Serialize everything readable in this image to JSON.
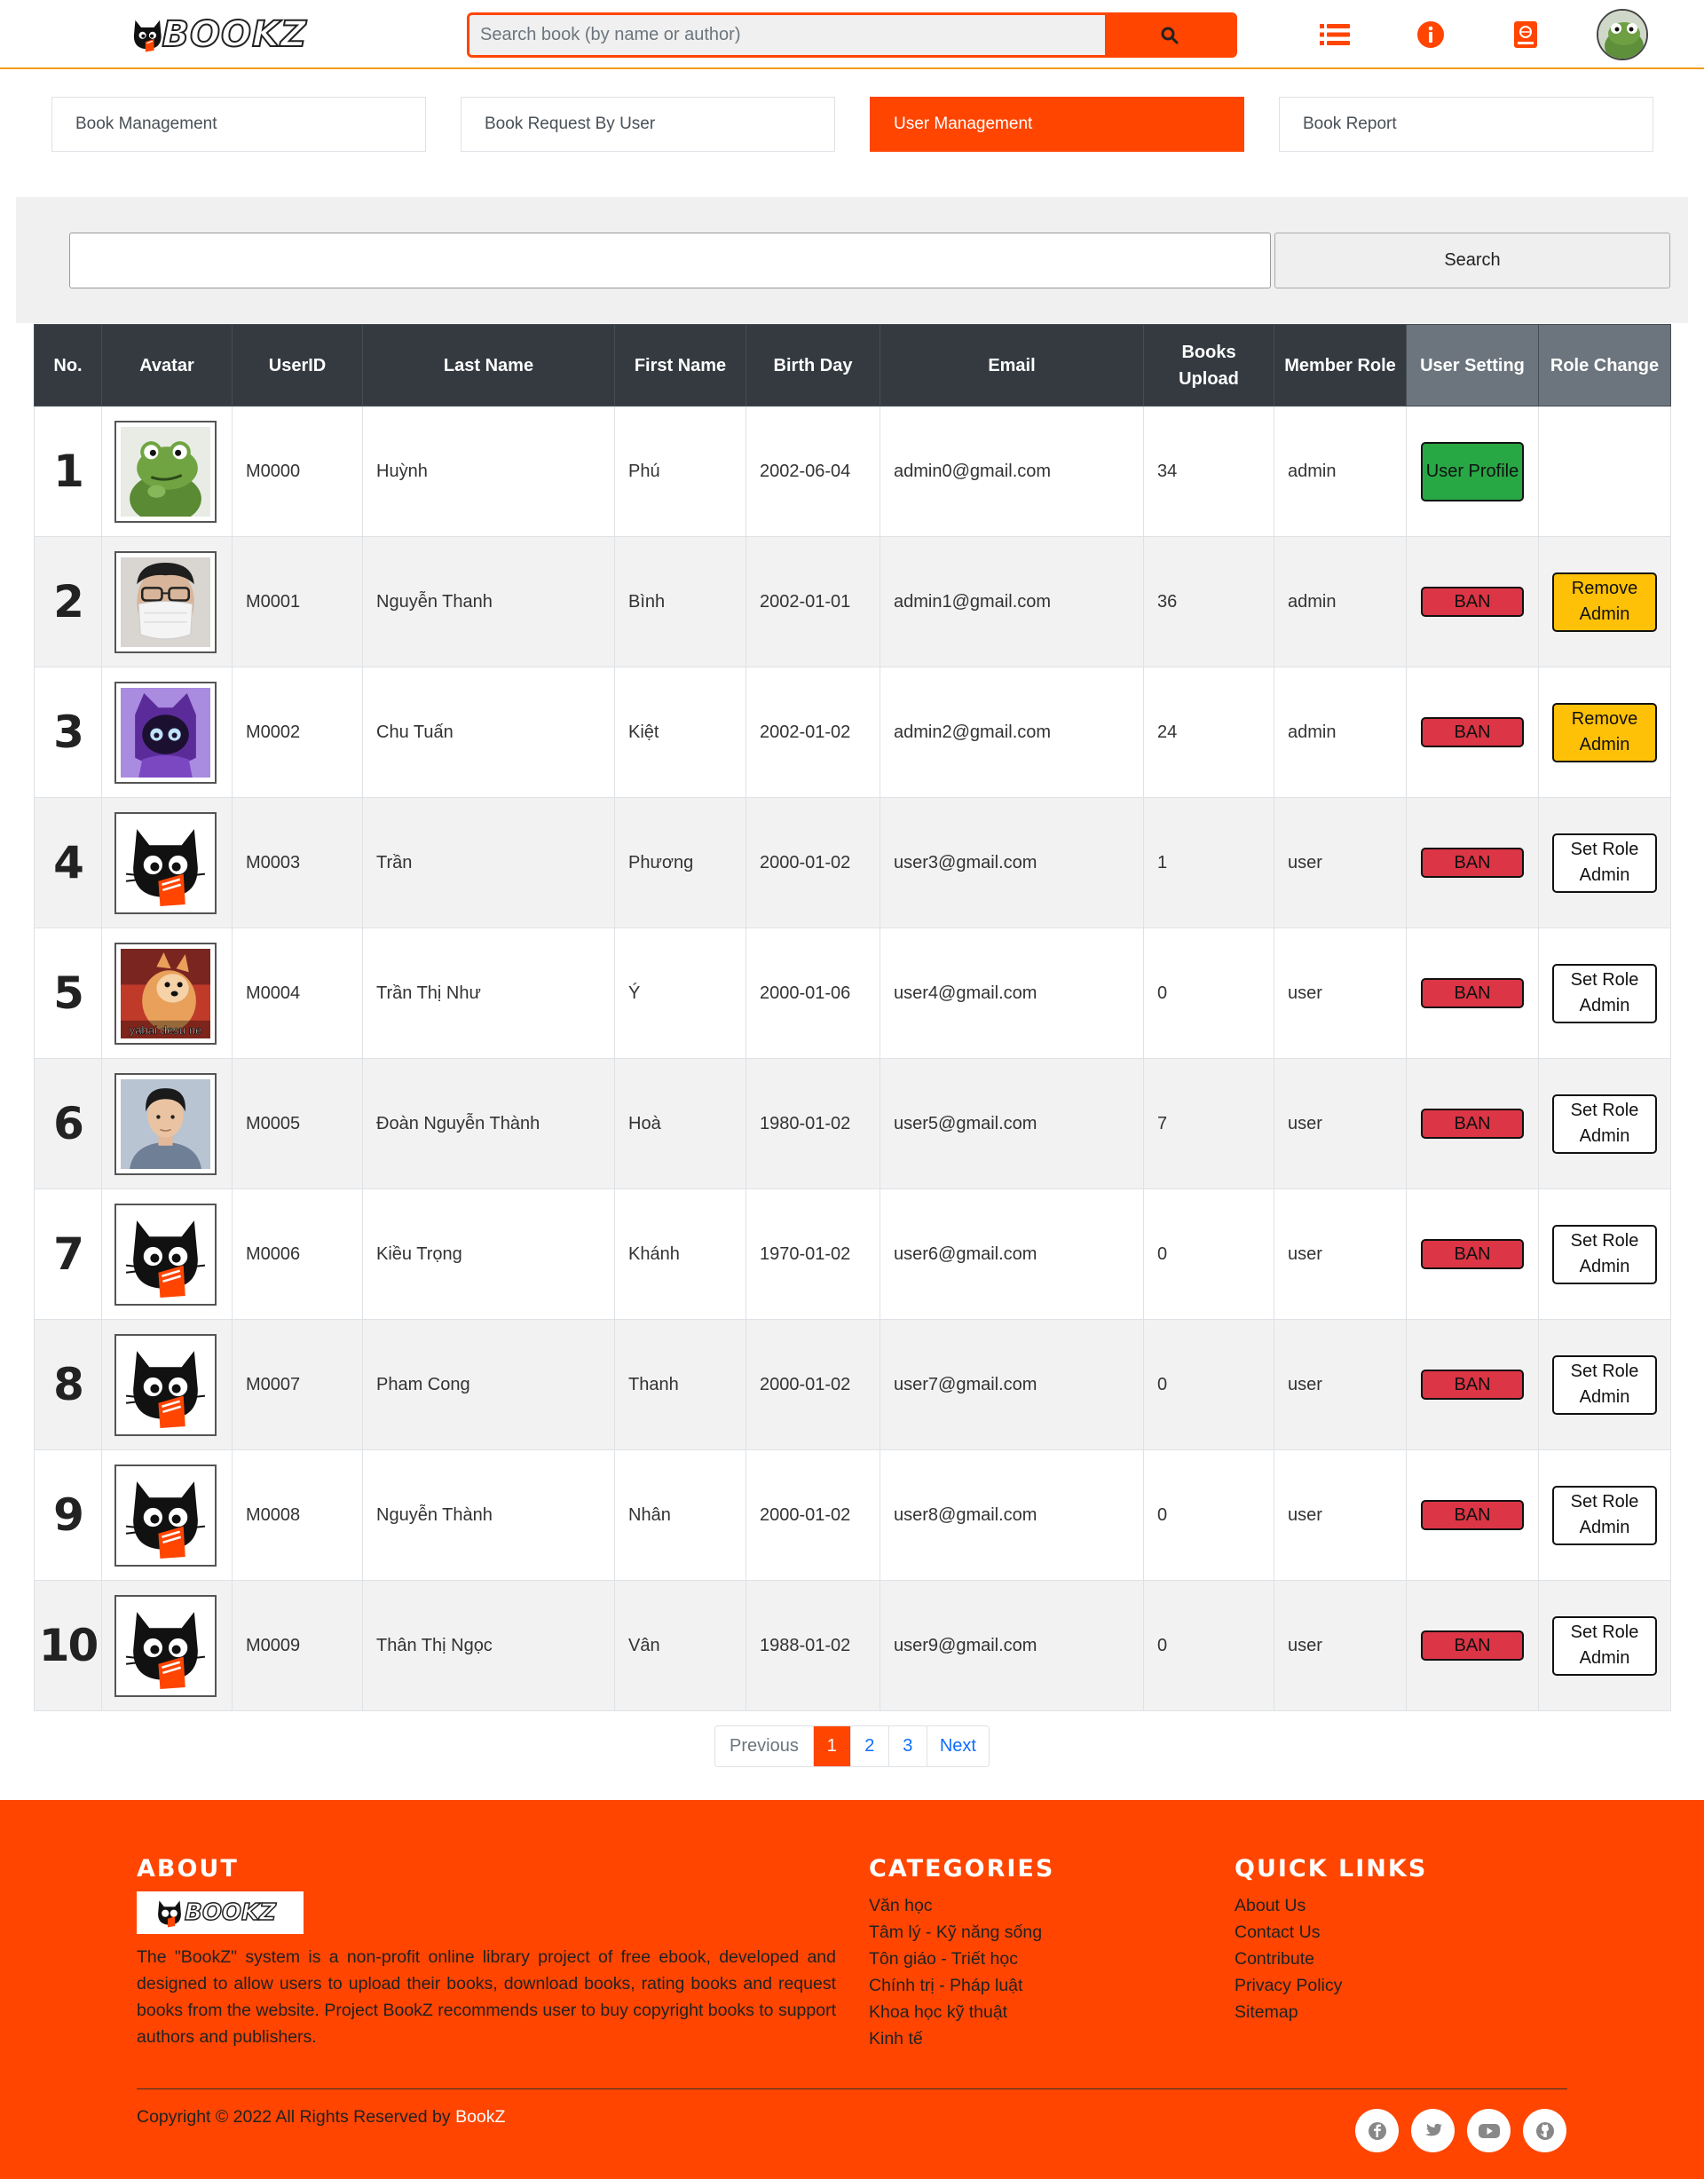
{
  "header": {
    "logo_text": "BOOKZ",
    "search_placeholder": "Search book (by name or author)",
    "icons": [
      "list-icon",
      "info-icon",
      "book-icon",
      "user-avatar"
    ]
  },
  "tabs": [
    {
      "label": "Book Management",
      "active": false
    },
    {
      "label": "Book Request By User",
      "active": false
    },
    {
      "label": "User Management",
      "active": true
    },
    {
      "label": "Book Report",
      "active": false
    }
  ],
  "user_search": {
    "value": "",
    "button_label": "Search"
  },
  "table": {
    "headers": [
      "No.",
      "Avatar",
      "UserID",
      "Last Name",
      "First Name",
      "Birth Day",
      "Email",
      "Books Upload",
      "Member Role",
      "User Setting",
      "Role Change"
    ],
    "rows": [
      {
        "no": "1",
        "avatar": "frog",
        "user_id": "M0000",
        "last_name": "Huỳnh",
        "first_name": "Phú",
        "birthday": "2002-06-04",
        "email": "admin0@gmail.com",
        "books": "34",
        "role": "admin",
        "setting": "User Profile",
        "role_change": ""
      },
      {
        "no": "2",
        "avatar": "masked-man",
        "user_id": "M0001",
        "last_name": "Nguyễn Thanh",
        "first_name": "Bình",
        "birthday": "2002-01-01",
        "email": "admin1@gmail.com",
        "books": "36",
        "role": "admin",
        "setting": "BAN",
        "role_change": "Remove Admin"
      },
      {
        "no": "3",
        "avatar": "purple-cat",
        "user_id": "M0002",
        "last_name": "Chu Tuấn",
        "first_name": "Kiệt",
        "birthday": "2002-01-02",
        "email": "admin2@gmail.com",
        "books": "24",
        "role": "admin",
        "setting": "BAN",
        "role_change": "Remove Admin"
      },
      {
        "no": "4",
        "avatar": "bookz-cat",
        "user_id": "M0003",
        "last_name": "Trần",
        "first_name": "Phương",
        "birthday": "2000-01-02",
        "email": "user3@gmail.com",
        "books": "1",
        "role": "user",
        "setting": "BAN",
        "role_change": "Set Role Admin"
      },
      {
        "no": "5",
        "avatar": "yabai-dog",
        "avatar_caption": "yabai desu ne",
        "user_id": "M0004",
        "last_name": "Trần Thị Như",
        "first_name": "Ý",
        "birthday": "2000-01-06",
        "email": "user4@gmail.com",
        "books": "0",
        "role": "user",
        "setting": "BAN",
        "role_change": "Set Role Admin"
      },
      {
        "no": "6",
        "avatar": "portrait",
        "user_id": "M0005",
        "last_name": "Đoàn Nguyễn Thành",
        "first_name": "Hoà",
        "birthday": "1980-01-02",
        "email": "user5@gmail.com",
        "books": "7",
        "role": "user",
        "setting": "BAN",
        "role_change": "Set Role Admin"
      },
      {
        "no": "7",
        "avatar": "bookz-cat",
        "user_id": "M0006",
        "last_name": "Kiều Trọng",
        "first_name": "Khánh",
        "birthday": "1970-01-02",
        "email": "user6@gmail.com",
        "books": "0",
        "role": "user",
        "setting": "BAN",
        "role_change": "Set Role Admin"
      },
      {
        "no": "8",
        "avatar": "bookz-cat",
        "user_id": "M0007",
        "last_name": "Pham Cong",
        "first_name": "Thanh",
        "birthday": "2000-01-02",
        "email": "user7@gmail.com",
        "books": "0",
        "role": "user",
        "setting": "BAN",
        "role_change": "Set Role Admin"
      },
      {
        "no": "9",
        "avatar": "bookz-cat",
        "user_id": "M0008",
        "last_name": "Nguyễn Thành",
        "first_name": "Nhân",
        "birthday": "2000-01-02",
        "email": "user8@gmail.com",
        "books": "0",
        "role": "user",
        "setting": "BAN",
        "role_change": "Set Role Admin"
      },
      {
        "no": "10",
        "avatar": "bookz-cat",
        "user_id": "M0009",
        "last_name": "Thân Thị Ngọc",
        "first_name": "Vân",
        "birthday": "1988-01-02",
        "email": "user9@gmail.com",
        "books": "0",
        "role": "user",
        "setting": "BAN",
        "role_change": "Set Role Admin"
      }
    ]
  },
  "pagination": {
    "previous": "Previous",
    "pages": [
      "1",
      "2",
      "3"
    ],
    "current": "1",
    "next": "Next"
  },
  "footer": {
    "about_heading": "ABOUT",
    "about_text": "The \"BookZ\" system is a non-profit online library project of free ebook, developed and designed to allow users to upload their books, download books, rating books and request books from the website. Project BookZ recommends user to buy copyright books to support authors and publishers.",
    "categories_heading": "CATEGORIES",
    "categories": [
      "Văn học",
      "Tâm lý - Kỹ năng sống",
      "Tôn giáo - Triết học",
      "Chính trị - Pháp luật",
      "Khoa học kỹ thuật",
      "Kinh tế"
    ],
    "links_heading": "QUICK LINKS",
    "links": [
      "About Us",
      "Contact Us",
      "Contribute",
      "Privacy Policy",
      "Sitemap"
    ],
    "copyright": "Copyright © 2022 All Rights Reserved by",
    "brand": "BookZ",
    "social": [
      "facebook-icon",
      "twitter-icon",
      "youtube-icon",
      "github-icon"
    ]
  },
  "colors": {
    "brand": "#ff4500",
    "header_dark": "#343a40",
    "header_muted": "#6c757d",
    "ban": "#dc3545",
    "profile": "#28a745",
    "remove_admin": "#ffc107"
  }
}
